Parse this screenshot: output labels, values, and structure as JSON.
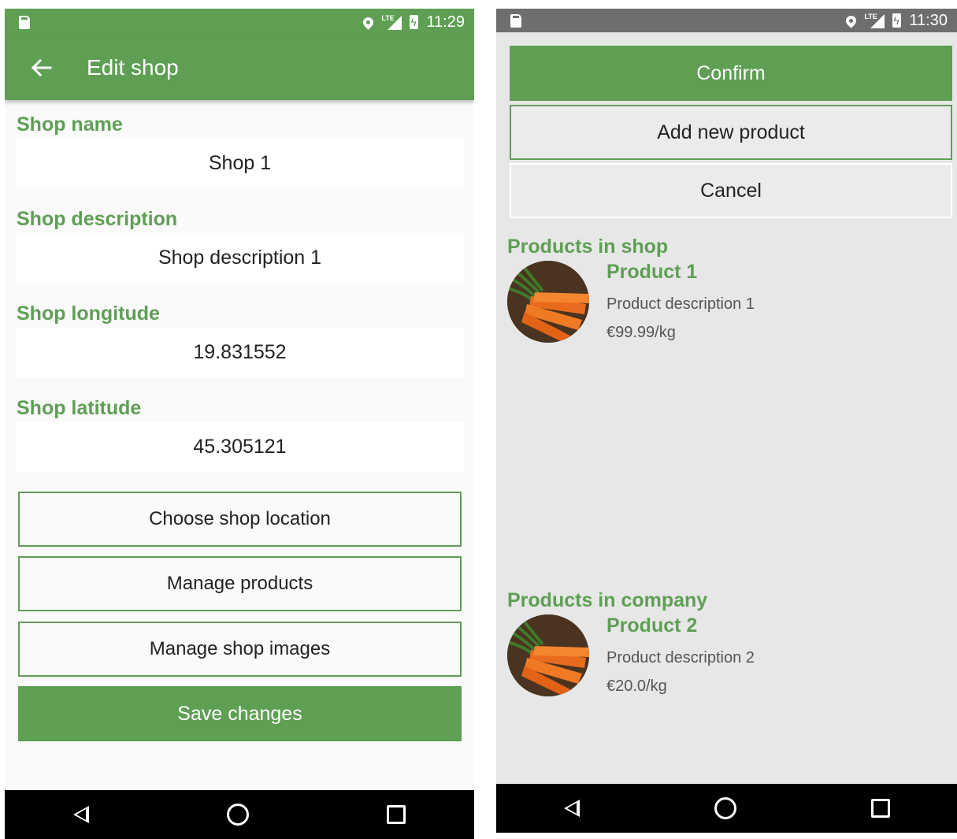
{
  "left": {
    "status": {
      "time": "11:29",
      "network": "LTE"
    },
    "appbar": {
      "title": "Edit shop"
    },
    "fields": [
      {
        "label": "Shop name",
        "value": "Shop 1"
      },
      {
        "label": "Shop description",
        "value": "Shop description 1"
      },
      {
        "label": "Shop longitude",
        "value": "19.831552"
      },
      {
        "label": "Shop latitude",
        "value": "45.305121"
      }
    ],
    "buttons": {
      "choose_location": "Choose shop location",
      "manage_products": "Manage products",
      "manage_images": "Manage shop images",
      "save": "Save changes"
    }
  },
  "right": {
    "status": {
      "time": "11:30",
      "network": "LTE"
    },
    "buttons": {
      "confirm": "Confirm",
      "add_product": "Add new product",
      "cancel": "Cancel"
    },
    "shop_section": {
      "title": "Products in shop",
      "products": [
        {
          "name": "Product 1",
          "description": "Product description 1",
          "price": "€99.99/kg"
        }
      ]
    },
    "company_section": {
      "title": "Products in company",
      "products": [
        {
          "name": "Product 2",
          "description": "Product description 2",
          "price": "€20.0/kg"
        }
      ]
    }
  },
  "colors": {
    "accent": "#5e9f54",
    "statusbar_right": "#6e6e6e",
    "navbar": "#000000"
  }
}
